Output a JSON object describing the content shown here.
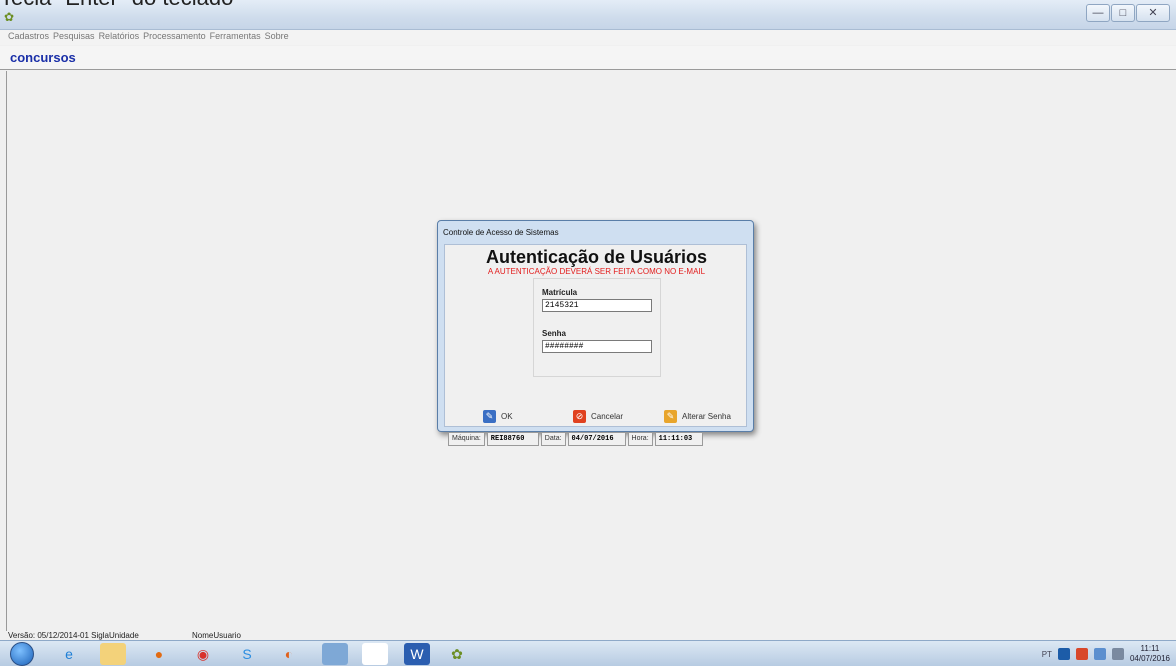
{
  "caption": "Tecla \"Enter\" do teclado",
  "window": {
    "controls": {
      "minimize": "—",
      "maximize": "□",
      "close": "✕"
    }
  },
  "menu": [
    "Cadastros",
    "Pesquisas",
    "Relatórios",
    "Processamento",
    "Ferramentas",
    "Sobre"
  ],
  "app": {
    "title": "concursos"
  },
  "dialog": {
    "title": "Controle de Acesso de Sistemas",
    "heading": "Autenticação de Usuários",
    "warning": "A AUTENTICAÇÃO DEVERÁ SER FEITA COMO NO E-MAIL",
    "matricula_label": "Matrícula",
    "matricula_value": "2145321",
    "senha_label": "Senha",
    "senha_value": "########",
    "buttons": {
      "ok": "OK",
      "cancel": "Cancelar",
      "change_password": "Alterar Senha"
    },
    "status": {
      "machine_label": "Máquina:",
      "machine_value": "REI88760",
      "date_label": "Data:",
      "date_value": "04/07/2016",
      "time_label": "Hora:",
      "time_value": "11:11:03"
    }
  },
  "statusbar": {
    "version": "Versão: 05/12/2014-01 SiglaUnidade",
    "user": "NomeUsuario"
  },
  "taskbar": {
    "apps": [
      "windows-media-icon",
      "ie-icon",
      "explorer-folder-icon",
      "media-player-icon",
      "chrome-icon",
      "skype-icon",
      "firefox-icon",
      "app-window-icon",
      "blank-document-icon",
      "word-icon",
      "paint-icon"
    ],
    "lang": "PT",
    "time": "11:11",
    "date": "04/07/2016"
  },
  "colors": {
    "accent_title": "#1a2fa8",
    "warning": "#e21b1b",
    "dialog_frame": "#cfdff1"
  }
}
